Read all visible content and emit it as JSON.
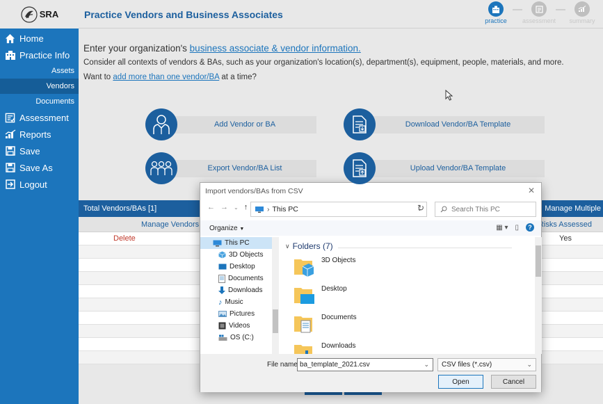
{
  "logo": {
    "text": "SRA"
  },
  "sidebar": {
    "items": [
      {
        "label": "Home"
      },
      {
        "label": "Practice Info"
      },
      {
        "label": "Assessment"
      },
      {
        "label": "Reports"
      },
      {
        "label": "Save"
      },
      {
        "label": "Save As"
      },
      {
        "label": "Logout"
      }
    ],
    "subitems": [
      {
        "label": "Assets"
      },
      {
        "label": "Vendors",
        "active": true
      },
      {
        "label": "Documents"
      }
    ]
  },
  "header": {
    "title": "Practice Vendors and Business Associates",
    "steps": [
      {
        "label": "practice",
        "state": "active"
      },
      {
        "label": "assessment",
        "state": "inactive"
      },
      {
        "label": "summary",
        "state": "inactive"
      }
    ]
  },
  "main": {
    "intro1_prefix": "Enter your organization's ",
    "intro1_link": "business associate & vendor information.",
    "intro2": "Consider all contexts of vendors & BAs, such as your organization's location(s), department(s), equipment, people, materials, and more.",
    "intro3_prefix": "Want to ",
    "intro3_link": "add more than one vendor/BA",
    "intro3_suffix": " at a time?",
    "actions": {
      "add": "Add Vendor or BA",
      "download": "Download Vendor/BA Template",
      "export": "Export Vendor/BA List",
      "upload": "Upload Vendor/BA Template"
    }
  },
  "table": {
    "total_label": "Total Vendors/BAs [1]",
    "manage_multiple": "Manage Multiple",
    "manage_vendors": "Manage Vendors",
    "risks_assessed": "Risks Assessed",
    "rows": [
      {
        "action": "Delete",
        "risks": "Yes"
      }
    ]
  },
  "dialog": {
    "title": "Import vendors/BAs from CSV",
    "address": "This PC",
    "search_placeholder": "Search This PC",
    "organize": "Organize",
    "tree": [
      {
        "label": "This PC",
        "selected": true,
        "level": "top"
      },
      {
        "label": "3D Objects",
        "level": "child"
      },
      {
        "label": "Desktop",
        "level": "child"
      },
      {
        "label": "Documents",
        "level": "child"
      },
      {
        "label": "Downloads",
        "level": "child"
      },
      {
        "label": "Music",
        "level": "child"
      },
      {
        "label": "Pictures",
        "level": "child"
      },
      {
        "label": "Videos",
        "level": "child"
      },
      {
        "label": "OS (C:)",
        "level": "child"
      }
    ],
    "group_header": "Folders (7)",
    "folders": [
      {
        "label": "3D Objects"
      },
      {
        "label": "Desktop"
      },
      {
        "label": "Documents"
      },
      {
        "label": "Downloads"
      }
    ],
    "file_name_label": "File name:",
    "file_name_value": "ba_template_2021.csv",
    "file_type": "CSV files (*.csv)",
    "open_label": "Open",
    "cancel_label": "Cancel"
  }
}
